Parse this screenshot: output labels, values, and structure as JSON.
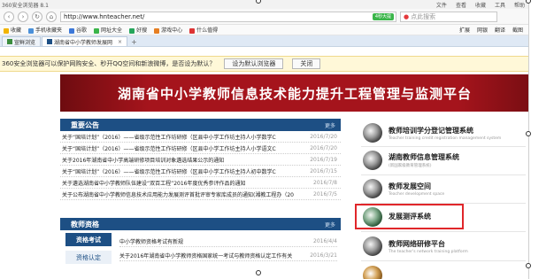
{
  "browser": {
    "title": "360安全浏览器 8.1",
    "menu": [
      "文件",
      "查看",
      "收藏",
      "工具",
      "帮助"
    ],
    "url": "http://www.hnteacher.net/",
    "speed_pill": "4秒大提",
    "search_placeholder": "点此搜索",
    "bookmarks": [
      "收藏",
      "手机收藏夹",
      "谷歌",
      "网址大全",
      "好搜",
      "游戏中心",
      "什么值得"
    ],
    "bookmarks_right": [
      "扩展",
      "网银",
      "翻译",
      "截图"
    ],
    "tabs": [
      {
        "label": "宣鲜浏览",
        "active": false
      },
      {
        "label": "湖南省中小学教师发展网",
        "active": true
      }
    ],
    "notification": "360安全浏览器可以保护网购安全、秒开QQ空间和新浪微博，是否设为默认？",
    "notification_set_default": "设为默认浏览器",
    "notification_close": "关闭"
  },
  "site": {
    "banner_title": "湖南省中小学教师信息技术能力提升工程管理与监测平台",
    "announcements": {
      "title": "重要公告",
      "more": "更多",
      "items": [
        {
          "text": "关于“国培计划”（2016）——省级示范性工作坊研修（区县中小学工作坊主持人小学数学C",
          "date": "2016/7/20"
        },
        {
          "text": "关于“国培计划”（2016）——省级示范性工作坊研修（区县中小学工作坊主持人小学语文C",
          "date": "2016/7/20"
        },
        {
          "text": "关于2016年湖南省中小学高端研修项目培训对象遴选结果公示的通知",
          "date": "2016/7/19"
        },
        {
          "text": "关于“国培计划”（2016）——省级示范性工作坊研修（区县中小学工作坊主持人初中数学C",
          "date": "2016/7/15"
        },
        {
          "text": "关于遴选湖南省中小学教师队伍建设“双百工程”2016年度优秀参评作品的通知",
          "date": "2016/7/8"
        },
        {
          "text": "关于公布湖南省中小学教师信息技术应用能力发展测评首批评审专家库成员的通知(湘教工程办（20",
          "date": "2016/7/5"
        }
      ]
    },
    "qualifications": {
      "title": "教师资格",
      "more": "更多",
      "tabs": [
        "资格考试",
        "资格认定"
      ],
      "items": [
        {
          "text": "中小学教师资格考试有新规",
          "date": "2016/4/4"
        },
        {
          "text": "关于2016年湖南省中小学教师资格国家统一考试与教师资格认定工作有关",
          "date": "2016/3/21"
        }
      ]
    },
    "systems": [
      {
        "name": "教师培训学分登记管理系统",
        "sub": "Teacher training credit registration management system"
      },
      {
        "name": "湖南教师信息管理系统",
        "sub": "(新国家级教育管理系统)"
      },
      {
        "name": "教师发展空间",
        "sub": "Teacher development space"
      },
      {
        "name": "发展测评系统",
        "sub": ""
      },
      {
        "name": "教师网络研修平台",
        "sub": "The teacher's network training platform"
      }
    ]
  },
  "colors": {
    "banner": "#a5141c",
    "panel_header": "#1d4f84",
    "highlight": "#e0262a",
    "active_tab_bg": "#1d4f84"
  }
}
